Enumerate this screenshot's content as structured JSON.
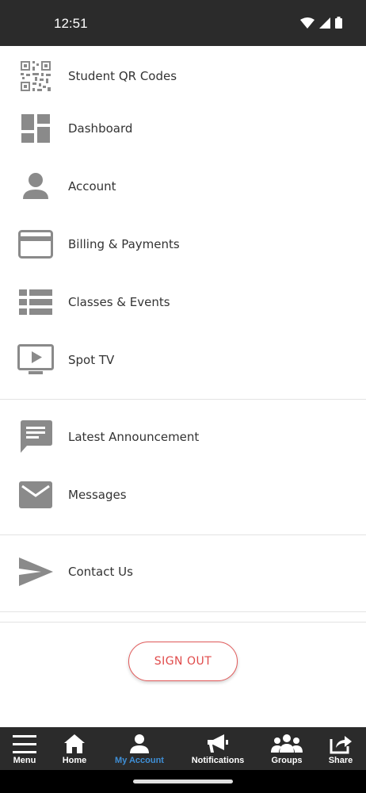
{
  "status_bar": {
    "time": "12:51"
  },
  "menu": {
    "items": [
      {
        "label": "Student QR Codes",
        "icon": "qr-code-icon"
      },
      {
        "label": "Dashboard",
        "icon": "dashboard-icon"
      },
      {
        "label": "Account",
        "icon": "person-icon"
      },
      {
        "label": "Billing & Payments",
        "icon": "credit-card-icon"
      },
      {
        "label": "Classes & Events",
        "icon": "list-icon"
      },
      {
        "label": "Spot TV",
        "icon": "tv-play-icon"
      },
      {
        "label": "Latest Announcement",
        "icon": "chat-message-icon"
      },
      {
        "label": "Messages",
        "icon": "envelope-icon"
      },
      {
        "label": "Contact Us",
        "icon": "send-icon"
      }
    ]
  },
  "sign_out": {
    "label": "SIGN OUT"
  },
  "bottom_nav": {
    "items": [
      {
        "label": "Menu",
        "icon": "hamburger-icon",
        "active": false
      },
      {
        "label": "Home",
        "icon": "home-icon",
        "active": false
      },
      {
        "label": "My Account",
        "icon": "account-icon",
        "active": true
      },
      {
        "label": "Notifications",
        "icon": "megaphone-icon",
        "active": false
      },
      {
        "label": "Groups",
        "icon": "groups-icon",
        "active": false
      },
      {
        "label": "Share",
        "icon": "share-icon",
        "active": false
      }
    ]
  },
  "colors": {
    "accent": "#3f8fd6",
    "signout": "#e04a4a",
    "icon_gray": "#8a8a8a",
    "bar": "#2b2b2b"
  }
}
